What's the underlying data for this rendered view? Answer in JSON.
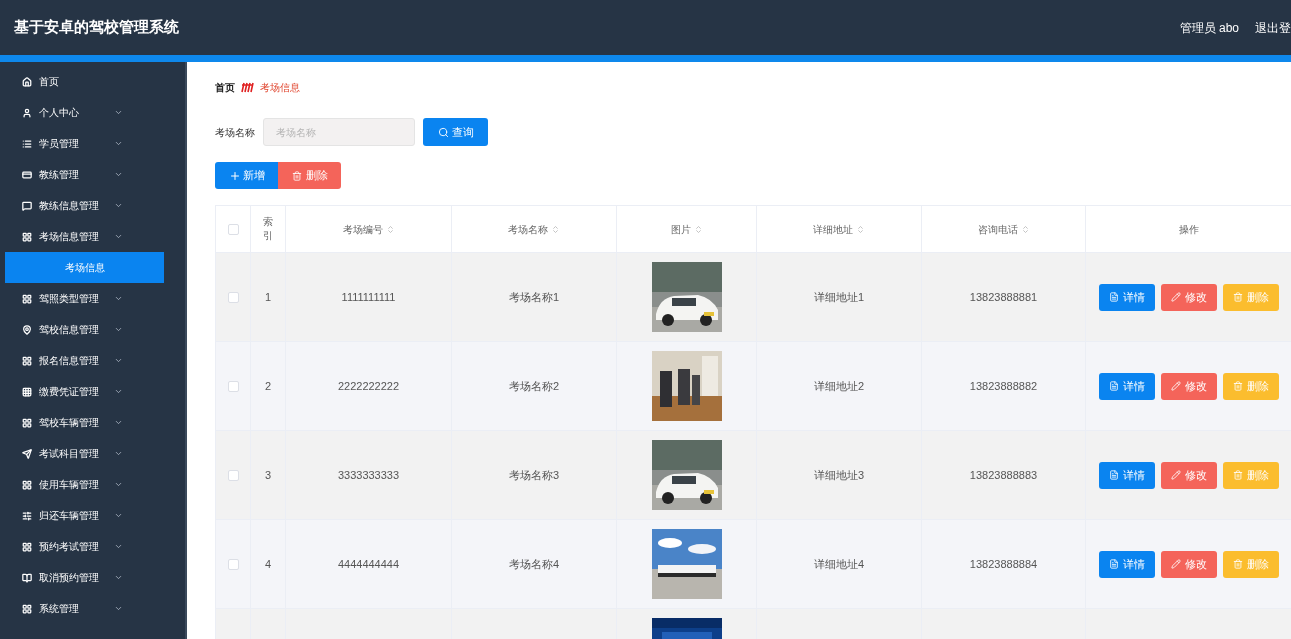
{
  "header": {
    "title": "基于安卓的驾校管理系统",
    "user": "管理员 abo",
    "logout": "退出登"
  },
  "sidebar": {
    "items": [
      {
        "label": "首页",
        "kind": "link"
      },
      {
        "label": "个人中心",
        "kind": "menu"
      },
      {
        "label": "学员管理",
        "kind": "menu"
      },
      {
        "label": "教练管理",
        "kind": "menu"
      },
      {
        "label": "教练信息管理",
        "kind": "menu"
      },
      {
        "label": "考场信息管理",
        "kind": "menu",
        "children": [
          {
            "label": "考场信息",
            "selected": true
          }
        ]
      },
      {
        "label": "驾照类型管理",
        "kind": "menu"
      },
      {
        "label": "驾校信息管理",
        "kind": "menu"
      },
      {
        "label": "报名信息管理",
        "kind": "menu"
      },
      {
        "label": "缴费凭证管理",
        "kind": "menu"
      },
      {
        "label": "驾校车辆管理",
        "kind": "menu"
      },
      {
        "label": "考试科目管理",
        "kind": "menu"
      },
      {
        "label": "使用车辆管理",
        "kind": "menu"
      },
      {
        "label": "归还车辆管理",
        "kind": "menu"
      },
      {
        "label": "预约考试管理",
        "kind": "menu"
      },
      {
        "label": "取消预约管理",
        "kind": "menu"
      },
      {
        "label": "系统管理",
        "kind": "menu"
      }
    ]
  },
  "breadcrumb": [
    "首页",
    "考场信息"
  ],
  "search": {
    "label": "考场名称",
    "placeholder": "考场名称",
    "button": "查询"
  },
  "actions": {
    "add": "新增",
    "delete": "删除"
  },
  "table": {
    "select_all_checked": false,
    "columns": [
      {
        "label": "索引",
        "sortable": false
      },
      {
        "label": "考场编号",
        "sortable": true
      },
      {
        "label": "考场名称",
        "sortable": true
      },
      {
        "label": "图片",
        "sortable": true
      },
      {
        "label": "详细地址",
        "sortable": true
      },
      {
        "label": "咨询电话",
        "sortable": true
      },
      {
        "label": "操作",
        "sortable": false
      }
    ],
    "rows": [
      {
        "checked": false,
        "index": "1",
        "code": "1111111111",
        "name": "考场名称1",
        "address": "详细地址1",
        "phone": "13823888881",
        "buttons": [
          "详情",
          "修改",
          "删除"
        ]
      },
      {
        "checked": false,
        "index": "2",
        "code": "2222222222",
        "name": "考场名称2",
        "address": "详细地址2",
        "phone": "13823888882",
        "buttons": [
          "详情",
          "修改",
          "删除"
        ]
      },
      {
        "checked": false,
        "index": "3",
        "code": "3333333333",
        "name": "考场名称3",
        "address": "详细地址3",
        "phone": "13823888883",
        "buttons": [
          "详情",
          "修改",
          "删除"
        ]
      },
      {
        "checked": false,
        "index": "4",
        "code": "4444444444",
        "name": "考场名称4",
        "address": "详细地址4",
        "phone": "13823888884",
        "buttons": [
          "详情",
          "修改",
          "删除"
        ]
      }
    ],
    "partial_row": true
  }
}
